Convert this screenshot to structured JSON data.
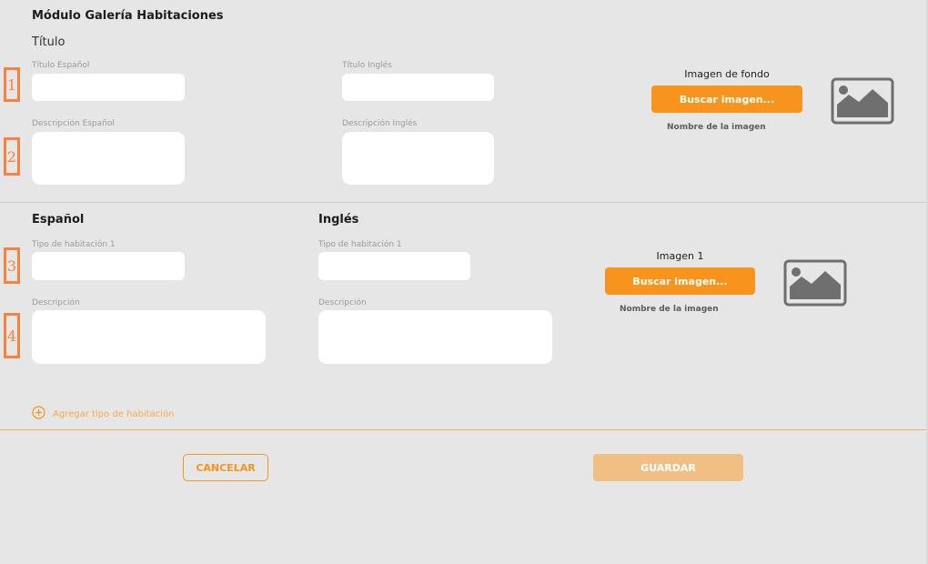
{
  "module": {
    "title": "Módulo Galería Habitaciones",
    "subtitle": "Título"
  },
  "header_form": {
    "title_es_label": "Título Español",
    "title_en_label": "Título Inglés",
    "desc_es_label": "Descripción Español",
    "desc_en_label": "Descripción Inglés",
    "title_es_value": "",
    "title_en_value": "",
    "desc_es_value": "",
    "desc_en_value": "",
    "background_image": {
      "caption": "Imagen de fondo",
      "button": "Buscar imagen...",
      "filename": "Nombre de la imagen",
      "icon": "image-placeholder-icon"
    }
  },
  "markers": [
    "1",
    "2",
    "3",
    "4"
  ],
  "rooms": {
    "spanish_heading": "Español",
    "english_heading": "Inglés",
    "room_type_es_label": "Tipo de habitación 1",
    "room_type_en_label": "Tipo de habitación 1",
    "desc_es_label": "Descripción",
    "desc_en_label": "Descripción",
    "room_type_es_value": "",
    "room_type_en_value": "",
    "desc_es_value": "",
    "desc_en_value": "",
    "image": {
      "caption": "Imagen 1",
      "button": "Buscar imagen...",
      "filename": "Nombre de la imagen",
      "icon": "image-placeholder-icon"
    },
    "add_link": "Agregar tipo de habitación",
    "add_icon": "plus-circle-icon"
  },
  "actions": {
    "cancel": "CANCELAR",
    "save": "GUARDAR"
  },
  "colors": {
    "accent": "#f7941d",
    "accent_disabled": "#f1bf84",
    "marker": "#f7823f",
    "icon_gray": "#6f6f6f",
    "background": "#e6e6e6"
  }
}
